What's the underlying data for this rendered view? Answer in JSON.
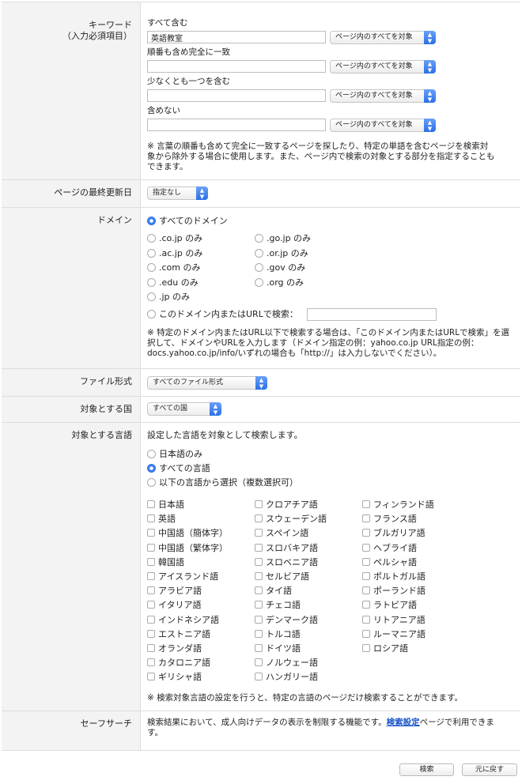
{
  "keyword": {
    "label": "キーワード",
    "sublabel": "（入力必須項目）",
    "fields": [
      {
        "label": "すべて含む",
        "value": "英語教室",
        "scope": "ページ内のすべてを対象"
      },
      {
        "label": "順番も含め完全に一致",
        "value": "",
        "scope": "ページ内のすべてを対象"
      },
      {
        "label": "少なくとも一つを含む",
        "value": "",
        "scope": "ページ内のすべてを対象"
      },
      {
        "label": "含めない",
        "value": "",
        "scope": "ページ内のすべてを対象"
      }
    ],
    "note": "※ 言葉の順番も含めて完全に一致するページを探したり、特定の単語を含むページを検索対象から除外する場合に使用します。また、ページ内で検索の対象とする部分を指定することもできます。"
  },
  "lastupdate": {
    "label": "ページの最終更新日",
    "value": "指定なし"
  },
  "domain": {
    "label": "ドメイン",
    "all": "すべてのドメイン",
    "options": [
      ".co.jp のみ",
      ".go.jp のみ",
      ".ac.jp のみ",
      ".or.jp のみ",
      ".com のみ",
      ".gov のみ",
      ".edu のみ",
      ".org のみ",
      ".jp のみ"
    ],
    "custom": "このドメイン内またはURLで検索：",
    "custom_value": "",
    "note": "※ 特定のドメイン内またはURL以下で検索する場合は、「このドメイン内またはURLで検索」を選択して、ドメインやURLを入力します（ドメイン指定の例：yahoo.co.jp URL指定の例：docs.yahoo.co.jp/info/いずれの場合も「http://」は入力しないでください）。"
  },
  "filetype": {
    "label": "ファイル形式",
    "value": "すべてのファイル形式"
  },
  "country": {
    "label": "対象とする国",
    "value": "すべての国"
  },
  "language": {
    "label": "対象とする言語",
    "intro": "設定した言語を対象として検索します。",
    "modes": [
      "日本語のみ",
      "すべての言語",
      "以下の言語から選択（複数選択可）"
    ],
    "selected_mode": 1,
    "columns": [
      [
        "日本語",
        "英語",
        "中国語（簡体字）",
        "中国語（繁体字）",
        "韓国語",
        "アイスランド語",
        "アラビア語",
        "イタリア語",
        "インドネシア語",
        "エストニア語",
        "オランダ語",
        "カタロニア語",
        "ギリシャ語"
      ],
      [
        "クロアチア語",
        "スウェーデン語",
        "スペイン語",
        "スロバキア語",
        "スロベニア語",
        "セルビア語",
        "タイ語",
        "チェコ語",
        "デンマーク語",
        "トルコ語",
        "ドイツ語",
        "ノルウェー語",
        "ハンガリー語"
      ],
      [
        "フィンランド語",
        "フランス語",
        "ブルガリア語",
        "ヘブライ語",
        "ペルシャ語",
        "ポルトガル語",
        "ポーランド語",
        "ラトビア語",
        "リトアニア語",
        "ルーマニア語",
        "ロシア語"
      ]
    ],
    "note": "※ 検索対象言語の設定を行うと、特定の言語のページだけ検索することができます。"
  },
  "safesearch": {
    "label": "セーフサーチ",
    "text_before": "検索結果において、成人向けデータの表示を制限する機能です。",
    "link": "検索設定",
    "text_after": "ページで利用できます。"
  },
  "buttons": {
    "search": "検索",
    "reset": "元に戻す"
  }
}
